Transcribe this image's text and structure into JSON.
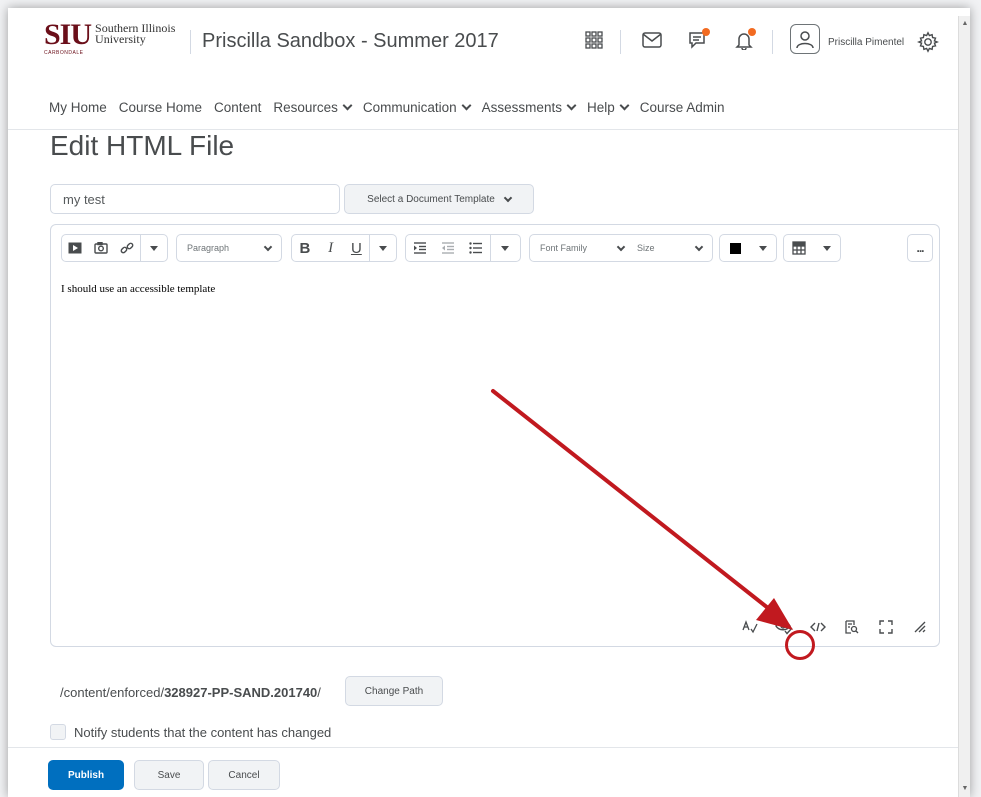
{
  "header": {
    "logo_mark": "SIU",
    "logo_line1": "Southern Illinois",
    "logo_line2": "University",
    "logo_sub": "CARBONDALE",
    "course_title": "Priscilla Sandbox - Summer 2017",
    "user_name": "Priscilla Pimentel",
    "icons": [
      "grid-icon",
      "mail-icon",
      "chat-icon",
      "bell-icon",
      "user-icon",
      "gear-icon"
    ]
  },
  "nav": {
    "items": [
      {
        "label": "My Home",
        "dropdown": false
      },
      {
        "label": "Course Home",
        "dropdown": false
      },
      {
        "label": "Content",
        "dropdown": false
      },
      {
        "label": "Resources",
        "dropdown": true
      },
      {
        "label": "Communication",
        "dropdown": true
      },
      {
        "label": "Assessments",
        "dropdown": true
      },
      {
        "label": "Help",
        "dropdown": true
      },
      {
        "label": "Course Admin",
        "dropdown": false
      }
    ]
  },
  "page": {
    "title": "Edit HTML File",
    "title_input_value": "my test",
    "template_button": "Select a Document Template"
  },
  "editor": {
    "format_select": "Paragraph",
    "font_family_select": "Font Family",
    "size_select": "Size",
    "more_label": "...",
    "content": "I should use an accessible template",
    "bold": "B",
    "italic": "I",
    "underline": "U"
  },
  "path": {
    "prefix": "/content/enforced/",
    "bold_part": "328927-PP-SAND.201740",
    "suffix": "/",
    "change_path_button": "Change Path"
  },
  "notify": {
    "label": "Notify students that the content has changed"
  },
  "footer": {
    "publish": "Publish",
    "save": "Save",
    "cancel": "Cancel"
  },
  "colors": {
    "primary": "#006fbf",
    "highlight": "#c1191f",
    "brand": "#6b0f1a",
    "notification": "#f26b21"
  }
}
